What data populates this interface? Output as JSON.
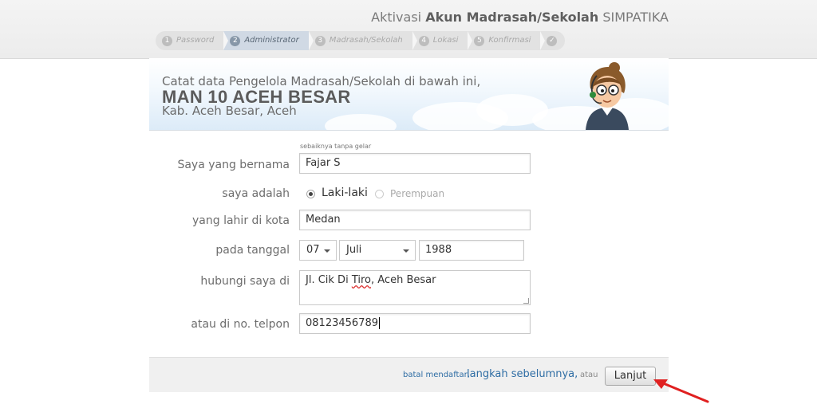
{
  "header": {
    "title_prefix": "Aktivasi",
    "title_bold": "Akun Madrasah/Sekolah",
    "title_suffix": "SIMPATIKA"
  },
  "steps": [
    {
      "num": "1",
      "label": "Password",
      "state": "done"
    },
    {
      "num": "2",
      "label": "Administrator",
      "state": "active"
    },
    {
      "num": "3",
      "label": "Madrasah/Sekolah",
      "state": "pending"
    },
    {
      "num": "4",
      "label": "Lokasi",
      "state": "pending"
    },
    {
      "num": "5",
      "label": "Konfirmasi",
      "state": "pending"
    },
    {
      "num": "✓",
      "label": "",
      "state": "pending"
    }
  ],
  "banner": {
    "intro": "Catat data Pengelola Madrasah/Sekolah di bawah ini,",
    "school_name": "MAN 10 ACEH BESAR",
    "region": "Kab. Aceh Besar, Aceh"
  },
  "form": {
    "name": {
      "label": "Saya yang bernama",
      "hint": "sebaiknya tanpa gelar",
      "value": "Fajar S"
    },
    "gender": {
      "label": "saya adalah",
      "options": [
        "Laki-laki",
        "Perempuan"
      ],
      "selected": "Laki-laki"
    },
    "birth_city": {
      "label": "yang lahir di kota",
      "value": "Medan"
    },
    "birth_date": {
      "label": "pada tanggal",
      "day": "07",
      "month": "Juli",
      "year": "1988"
    },
    "address": {
      "label": "hubungi saya di",
      "value_part1": "Jl. Cik Di ",
      "value_spell": "Tiro",
      "value_part2": ", Aceh Besar"
    },
    "phone": {
      "label": "atau di no. telpon",
      "value": "08123456789"
    }
  },
  "footer": {
    "cancel_link": "batal mendaftar,",
    "back_link": "langkah sebelumnya,",
    "or_text": "atau",
    "next_button": "Lanjut"
  },
  "colors": {
    "link": "#2e6da4",
    "arrow": "#e02020"
  }
}
